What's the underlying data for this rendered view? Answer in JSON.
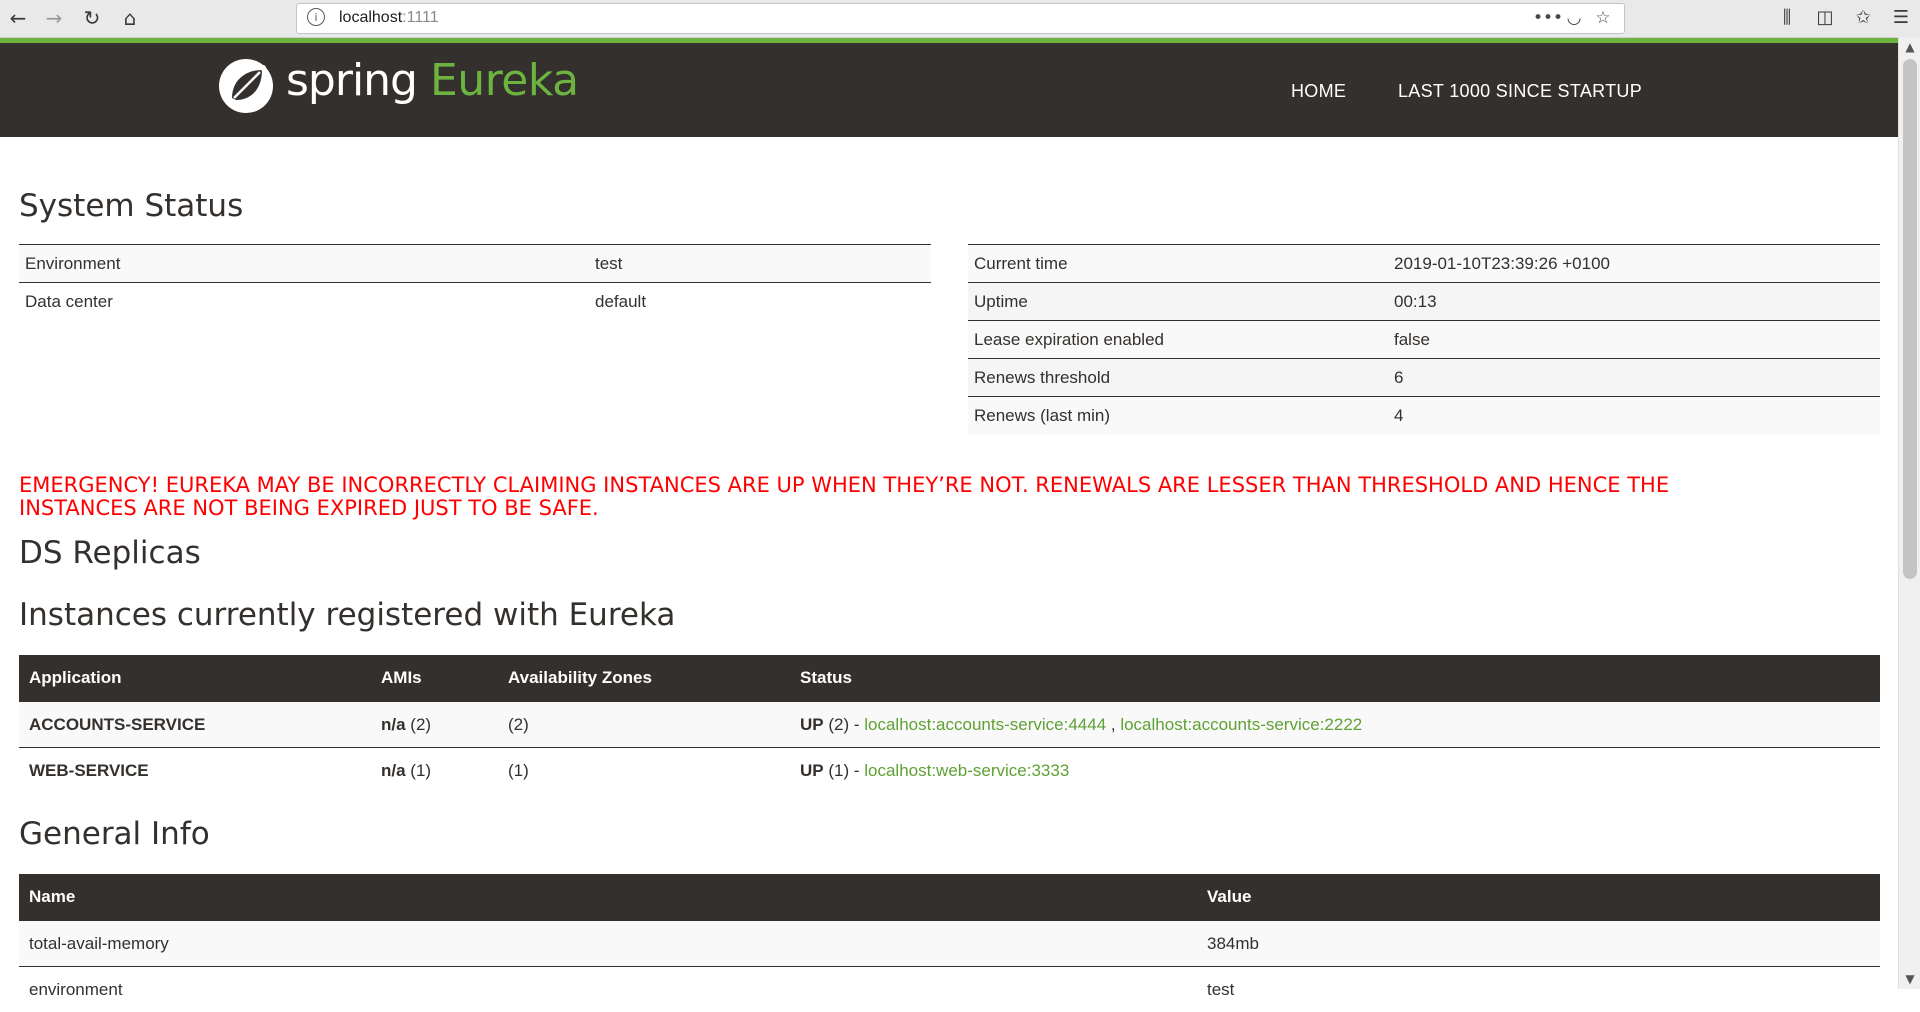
{
  "browser": {
    "url_host": "localhost",
    "url_port": ":1111"
  },
  "header": {
    "logo_spring": "spring",
    "logo_eureka": "Eureka",
    "nav_home": "HOME",
    "nav_last": "LAST 1000 SINCE STARTUP"
  },
  "system_status": {
    "title": "System Status",
    "left": [
      {
        "label": "Environment",
        "value": "test"
      },
      {
        "label": "Data center",
        "value": "default"
      }
    ],
    "right": [
      {
        "label": "Current time",
        "value": "2019-01-10T23:39:26 +0100"
      },
      {
        "label": "Uptime",
        "value": "00:13"
      },
      {
        "label": "Lease expiration enabled",
        "value": "false"
      },
      {
        "label": "Renews threshold",
        "value": "6"
      },
      {
        "label": "Renews (last min)",
        "value": "4"
      }
    ]
  },
  "emergency": {
    "line1": "EMERGENCY! EUREKA MAY BE INCORRECTLY CLAIMING INSTANCES ARE UP WHEN THEY’RE NOT. RENEWALS ARE LESSER THAN THRESHOLD AND HENCE THE",
    "line2": "INSTANCES ARE NOT BEING EXPIRED JUST TO BE SAFE."
  },
  "ds_replicas": {
    "title": "DS Replicas"
  },
  "instances": {
    "title": "Instances currently registered with Eureka",
    "headers": [
      "Application",
      "AMIs",
      "Availability Zones",
      "Status"
    ],
    "rows": [
      {
        "application": "ACCOUNTS-SERVICE",
        "ami_bold": "n/a",
        "ami_count": " (2)",
        "zones": "(2)",
        "status_bold": "UP",
        "status_count": " (2) - ",
        "link1": "localhost:accounts-service:4444",
        "separator": " , ",
        "link2": "localhost:accounts-service:2222"
      },
      {
        "application": "WEB-SERVICE",
        "ami_bold": "n/a",
        "ami_count": " (1)",
        "zones": "(1)",
        "status_bold": "UP",
        "status_count": " (1) - ",
        "link1": "localhost:web-service:3333"
      }
    ]
  },
  "general_info": {
    "title": "General Info",
    "headers": [
      "Name",
      "Value"
    ],
    "rows": [
      {
        "name": "total-avail-memory",
        "value": "384mb"
      },
      {
        "name": "environment",
        "value": "test"
      }
    ]
  },
  "colors": {
    "spring_green": "#6db33f",
    "header_dark": "#34302d",
    "emergency_red": "#ff0000"
  }
}
